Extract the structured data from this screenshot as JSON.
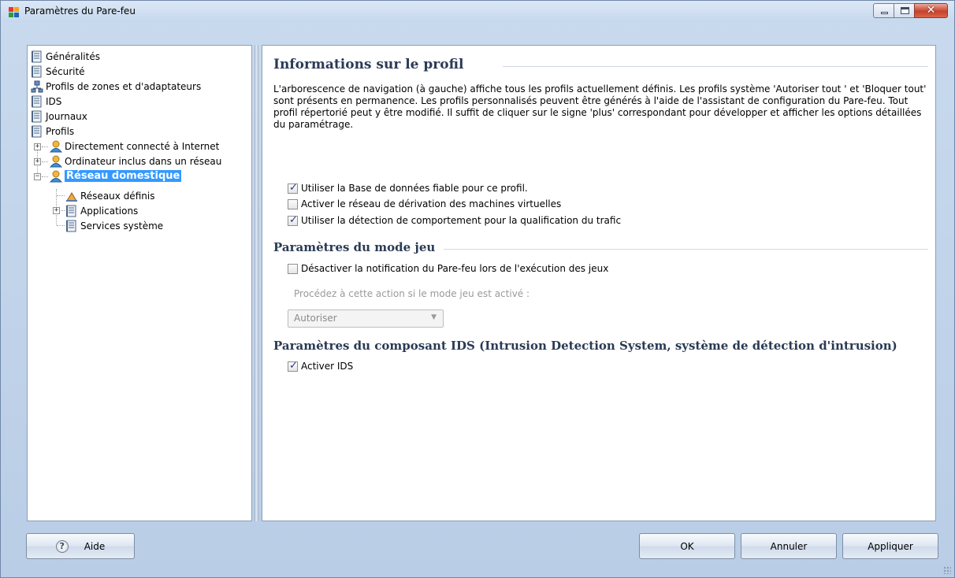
{
  "window": {
    "title": "Paramètres du Pare-feu",
    "close_glyph": "✕"
  },
  "tree": {
    "items": [
      {
        "label": "Généralités",
        "icon": "document-icon"
      },
      {
        "label": "Sécurité",
        "icon": "document-icon"
      },
      {
        "label": "Profils de zones et d'adaptateurs",
        "icon": "network-icon"
      },
      {
        "label": "IDS",
        "icon": "document-icon"
      },
      {
        "label": "Journaux",
        "icon": "document-icon"
      },
      {
        "label": "Profils",
        "icon": "document-icon"
      },
      {
        "label": "Directement connecté à Internet",
        "icon": "user-icon"
      },
      {
        "label": "Ordinateur inclus dans un réseau",
        "icon": "user-icon"
      },
      {
        "label": "Réseau domestique",
        "icon": "user-icon",
        "selected": true
      },
      {
        "label": "Réseaux définis",
        "icon": "network-icon"
      },
      {
        "label": "Applications",
        "icon": "document-icon"
      },
      {
        "label": "Services système",
        "icon": "document-icon"
      }
    ],
    "expander_plus": "+",
    "expander_minus": "−"
  },
  "content": {
    "profile_section": {
      "title": "Informations sur le profil",
      "description": "L'arborescence de navigation (à gauche) affiche tous les profils actuellement définis. Les profils système 'Autoriser tout ' et 'Bloquer tout' sont présents en permanence. Les profils personnalisés peuvent être générés à l'aide de l'assistant de configuration du Pare-feu. Tout profil répertorié peut y être modifié. Il suffit de cliquer sur le signe 'plus' correspondant pour développer et afficher les options détaillées du paramétrage.",
      "options": [
        {
          "label": "Utiliser la Base de données fiable pour ce profil.",
          "checked": true
        },
        {
          "label": "Activer le réseau de dérivation des machines virtuelles",
          "checked": false
        },
        {
          "label": "Utiliser la détection de comportement pour la qualification du trafic",
          "checked": true
        }
      ]
    },
    "game_section": {
      "title": "Paramètres du mode jeu",
      "option": {
        "label": "Désactiver la notification du Pare-feu lors de l'exécution des jeux",
        "checked": false
      },
      "action_label": "Procédez à cette action si le mode jeu est activé :",
      "action_value": "Autoriser"
    },
    "ids_section": {
      "title": "Paramètres du composant IDS (Intrusion Detection System, système de détection d'intrusion)",
      "option": {
        "label": "Activer IDS",
        "checked": true
      }
    }
  },
  "buttons": {
    "help": "Aide",
    "help_glyph": "?",
    "ok": "OK",
    "cancel": "Annuler",
    "apply": "Appliquer"
  },
  "colors": {
    "selection": "#3399ff",
    "section_title": "#2a3a55",
    "frame": "#c9daee"
  }
}
